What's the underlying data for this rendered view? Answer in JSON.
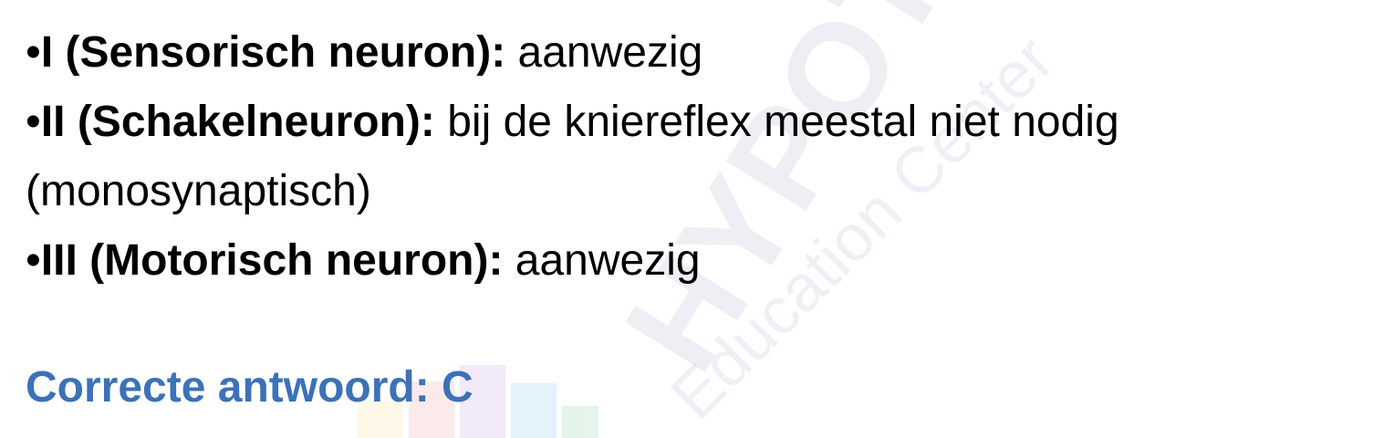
{
  "watermark": {
    "brand": "HYPOTENUSE",
    "subtitle": "Education Center"
  },
  "items": [
    {
      "bullet": "•",
      "label": "I (Sensorisch neuron):",
      "text": " aanwezig"
    },
    {
      "bullet": "•",
      "label": "II (Schakelneuron):",
      "text": "  bij de kniereflex meestal niet nodig"
    },
    {
      "bullet": "",
      "label": "",
      "text": "(monosynaptisch)"
    },
    {
      "bullet": "•",
      "label": "III (Motorisch neuron):",
      "text": "  aanwezig"
    }
  ],
  "answer": {
    "text": "Correcte antwoord: C",
    "color": "#3b72b8"
  }
}
